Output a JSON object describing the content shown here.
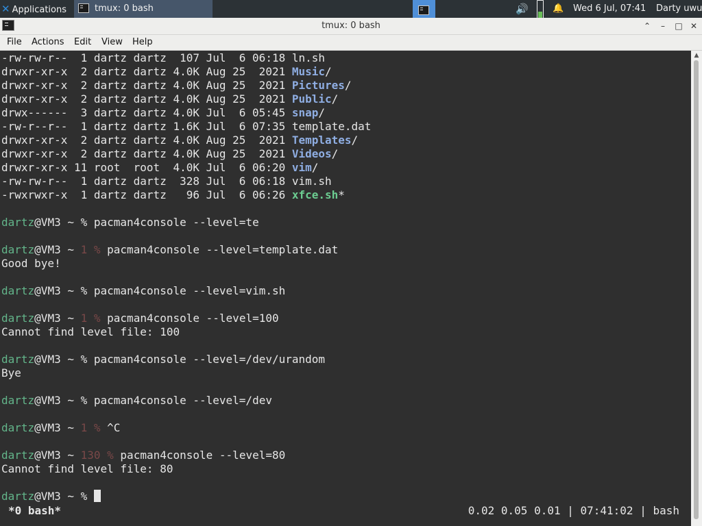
{
  "panel": {
    "apps_label": "Applications",
    "task_title": "tmux: 0 bash",
    "date": "Wed  6 Jul, 07:41",
    "user": "Darty uwu",
    "volume_icon": "🔊",
    "bell_icon": "🔔"
  },
  "window": {
    "title": "tmux: 0 bash",
    "min": "⌃",
    "shade": "–",
    "max": "□",
    "close": "✕"
  },
  "menu": [
    "File",
    "Actions",
    "Edit",
    "View",
    "Help"
  ],
  "listing": [
    {
      "perm": "-rw-rw-r--  1 dartz dartz  107 Jul  6 06:18 ",
      "name": "ln.sh",
      "kind": "file",
      "suffix": ""
    },
    {
      "perm": "drwxr-xr-x  2 dartz dartz 4.0K Aug 25  2021 ",
      "name": "Music",
      "kind": "dir",
      "suffix": "/"
    },
    {
      "perm": "drwxr-xr-x  2 dartz dartz 4.0K Aug 25  2021 ",
      "name": "Pictures",
      "kind": "dir",
      "suffix": "/"
    },
    {
      "perm": "drwxr-xr-x  2 dartz dartz 4.0K Aug 25  2021 ",
      "name": "Public",
      "kind": "dir",
      "suffix": "/"
    },
    {
      "perm": "drwx------  3 dartz dartz 4.0K Jul  6 05:45 ",
      "name": "snap",
      "kind": "dir",
      "suffix": "/"
    },
    {
      "perm": "-rw-r--r--  1 dartz dartz 1.6K Jul  6 07:35 ",
      "name": "template.dat",
      "kind": "file",
      "suffix": ""
    },
    {
      "perm": "drwxr-xr-x  2 dartz dartz 4.0K Aug 25  2021 ",
      "name": "Templates",
      "kind": "dir",
      "suffix": "/"
    },
    {
      "perm": "drwxr-xr-x  2 dartz dartz 4.0K Aug 25  2021 ",
      "name": "Videos",
      "kind": "dir",
      "suffix": "/"
    },
    {
      "perm": "drwxr-xr-x 11 root  root  4.0K Jul  6 06:20 ",
      "name": "vim",
      "kind": "dir",
      "suffix": "/"
    },
    {
      "perm": "-rw-rw-r--  1 dartz dartz  328 Jul  6 06:18 ",
      "name": "vim.sh",
      "kind": "file",
      "suffix": ""
    },
    {
      "perm": "-rwxrwxr-x  1 dartz dartz   96 Jul  6 06:26 ",
      "name": "xfce.sh",
      "kind": "exe",
      "suffix": "*"
    }
  ],
  "prompt_user": "dartz",
  "prompt_host": "@VM3 ~ ",
  "session": [
    {
      "blank": true
    },
    {
      "code": "",
      "cmd": "pacman4console --level=te"
    },
    {
      "blank": true
    },
    {
      "code": "1",
      "cmd": "pacman4console --level=template.dat"
    },
    {
      "out": "Good bye!"
    },
    {
      "blank": true
    },
    {
      "code": "",
      "cmd": "pacman4console --level=vim.sh"
    },
    {
      "blank": true
    },
    {
      "code": "1",
      "cmd": "pacman4console --level=100"
    },
    {
      "out": "Cannot find level file: 100"
    },
    {
      "blank": true
    },
    {
      "code": "",
      "cmd": "pacman4console --level=/dev/urandom"
    },
    {
      "out": "Bye"
    },
    {
      "blank": true
    },
    {
      "code": "",
      "cmd": "pacman4console --level=/dev"
    },
    {
      "blank": true
    },
    {
      "code": "1",
      "cmd": "^C"
    },
    {
      "blank": true
    },
    {
      "code": "130",
      "cmd": "pacman4console --level=80"
    },
    {
      "out": "Cannot find level file: 80"
    },
    {
      "blank": true
    },
    {
      "code": "",
      "cmd": "",
      "cursor": true
    }
  ],
  "tmux": {
    "window": "*0 bash*",
    "load": "0.02 0.05 0.01",
    "time": "07:41:02",
    "cmd": "bash",
    "sep": " | "
  }
}
